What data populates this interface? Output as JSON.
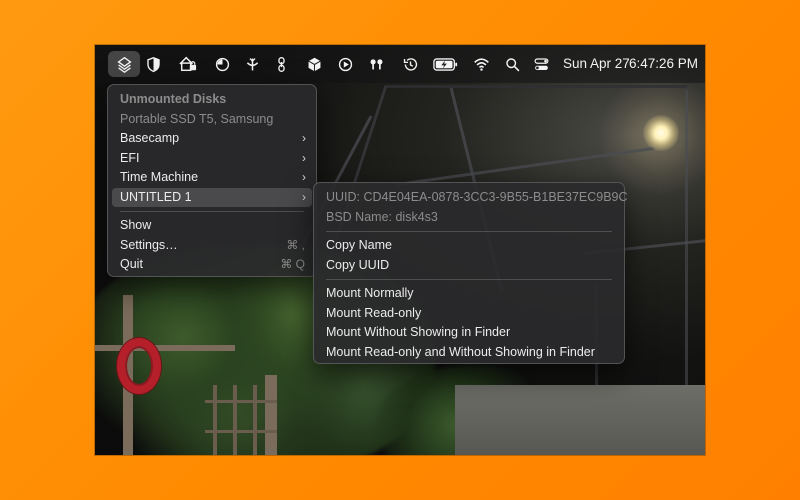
{
  "menubar": {
    "icons": [
      {
        "name": "mountain-disk-icon",
        "active": true
      },
      {
        "name": "shield-icon"
      },
      {
        "name": "network-lock-icon"
      },
      {
        "name": "circle-half-icon"
      },
      {
        "name": "ferry-anchor-icon"
      },
      {
        "name": "chain-link-icon"
      },
      {
        "name": "cube-icon"
      },
      {
        "name": "play-circle-icon"
      },
      {
        "name": "airpods-icon"
      },
      {
        "name": "time-machine-icon"
      },
      {
        "name": "battery-charging-icon"
      },
      {
        "name": "wifi-icon"
      },
      {
        "name": "spotlight-search-icon"
      },
      {
        "name": "control-center-icon"
      }
    ],
    "date": "Sun Apr 27",
    "time": "6:47:26 PM"
  },
  "main_menu": {
    "header": "Unmounted Disks",
    "device": "Portable SSD T5, Samsung",
    "volumes": [
      {
        "label": "Basecamp",
        "submenu": true
      },
      {
        "label": "EFI",
        "submenu": true
      },
      {
        "label": "Time Machine",
        "submenu": true
      },
      {
        "label": "UNTITLED 1",
        "submenu": true,
        "selected": true
      }
    ],
    "chevron": "›",
    "show": "Show",
    "settings": "Settings…",
    "settings_shortcut": "⌘ ,",
    "quit": "Quit",
    "quit_shortcut": "⌘ Q"
  },
  "sub_menu": {
    "uuid": "UUID: CD4E04EA-0878-3CC3-9B55-B1BE37EC9B9C",
    "bsd_name": "BSD Name: disk4s3",
    "copy_name": "Copy Name",
    "copy_uuid": "Copy UUID",
    "mount_normally": "Mount Normally",
    "mount_read_only": "Mount Read-only",
    "mount_without_finder": "Mount Without Showing in Finder",
    "mount_read_only_without_finder": "Mount Read-only and Without Showing in Finder"
  }
}
